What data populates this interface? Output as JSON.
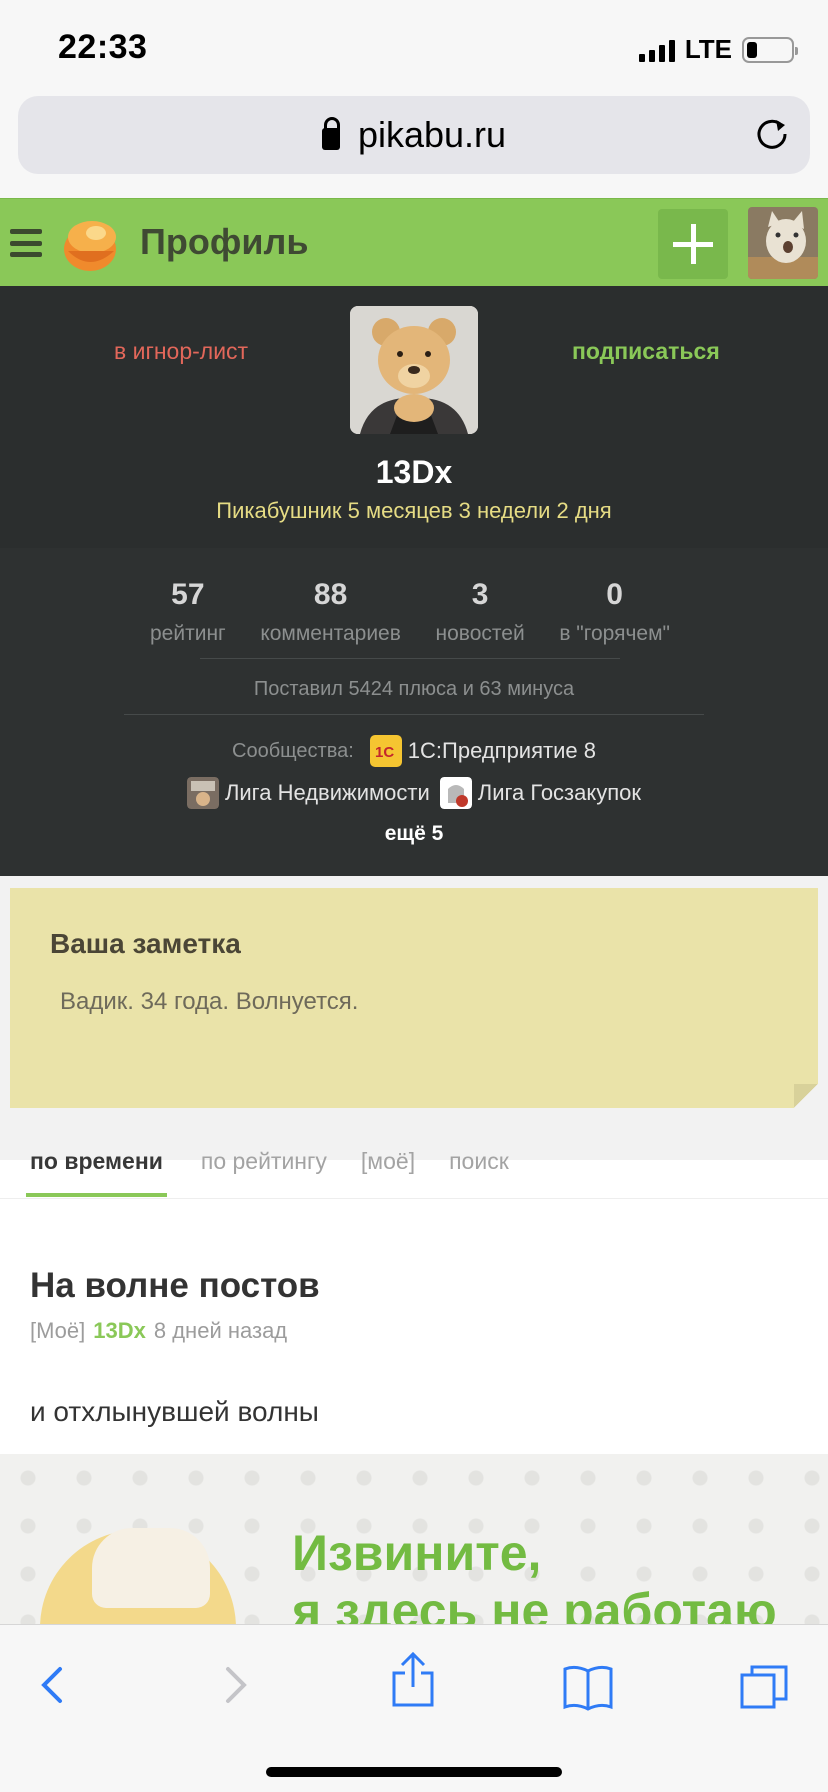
{
  "status_bar": {
    "time": "22:33",
    "network": "LTE"
  },
  "browser": {
    "url": "pikabu.ru"
  },
  "header": {
    "title": "Профиль"
  },
  "profile": {
    "ignore_label": "в игнор-лист",
    "subscribe_label": "подписаться",
    "nickname": "13Dx",
    "membership": "Пикабушник 5 месяцев 3 недели 2 дня",
    "stats": [
      {
        "value": "57",
        "label": "рейтинг"
      },
      {
        "value": "88",
        "label": "комментариев"
      },
      {
        "value": "3",
        "label": "новостей"
      },
      {
        "value": "0",
        "label": "в \"горячем\""
      }
    ],
    "votes": "Поставил 5424 плюса и 63 минуса",
    "communities_label": "Сообщества:",
    "communities": [
      {
        "name": "1С:Предприятие 8",
        "icon": "1c-icon"
      },
      {
        "name": "Лига Недвижимости",
        "icon": "realty-league-icon"
      },
      {
        "name": "Лига Госзакупок",
        "icon": "procurement-league-icon"
      }
    ],
    "more_label": "ещё 5"
  },
  "note": {
    "title": "Ваша заметка",
    "text": "Вадик. 34 года. Волнуется."
  },
  "tabs": [
    {
      "label": "по времени",
      "active": true
    },
    {
      "label": "по рейтингу",
      "active": false
    },
    {
      "label": "[моё]",
      "active": false
    },
    {
      "label": "поиск",
      "active": false
    }
  ],
  "post": {
    "title": "На волне постов",
    "tag": "[Моё]",
    "author": "13Dx",
    "time": "8 дней назад",
    "text": "и отхлынувшей волны"
  },
  "banner": {
    "line1": "Извините,",
    "line2": "я здесь не работаю"
  },
  "colors": {
    "brand_green": "#8ac858",
    "profile_bg": "#2e3131",
    "note_bg": "#eae3a9",
    "ignore_red": "#e2675a",
    "membership_yellow": "#e6dc84"
  }
}
